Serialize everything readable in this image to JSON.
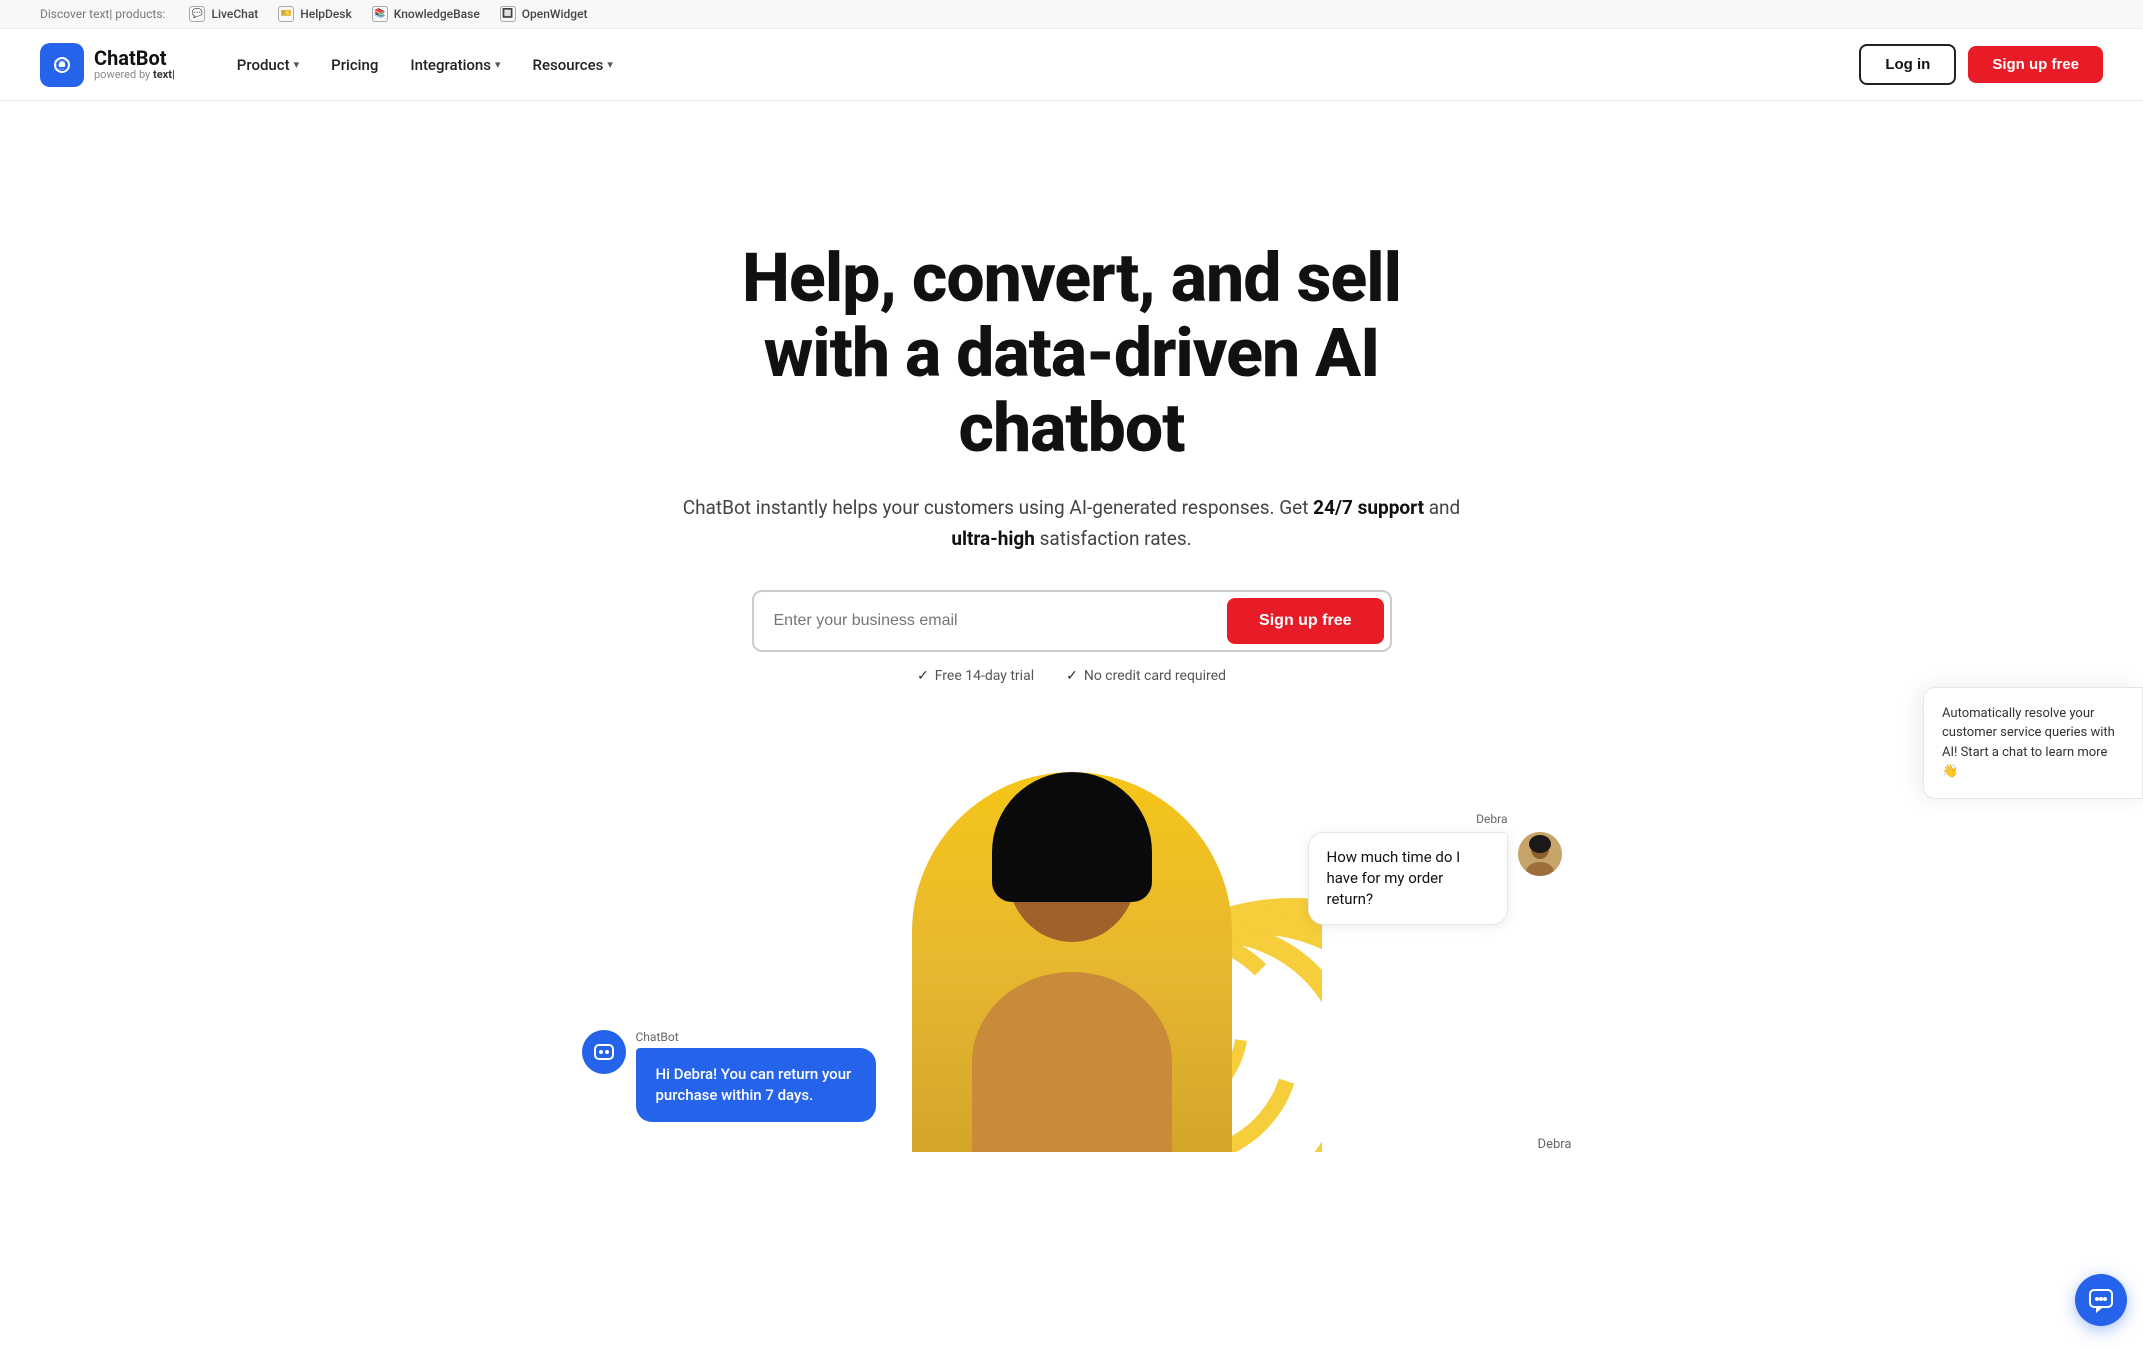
{
  "topbar": {
    "label": "Discover text| products:",
    "products": [
      {
        "name": "LiveChat",
        "icon": "💬"
      },
      {
        "name": "HelpDesk",
        "icon": "🎫"
      },
      {
        "name": "KnowledgeBase",
        "icon": "📚"
      },
      {
        "name": "OpenWidget",
        "icon": "🔲"
      }
    ]
  },
  "nav": {
    "logo_brand": "ChatBot",
    "logo_powered": "powered by text|",
    "product_label": "Product",
    "pricing_label": "Pricing",
    "integrations_label": "Integrations",
    "resources_label": "Resources",
    "login_label": "Log in",
    "signup_label": "Sign up free"
  },
  "hero": {
    "headline_line1": "Help, convert, and sell",
    "headline_line2": "with a data-driven AI chatbot",
    "subtext": "ChatBot instantly helps your customers using AI-generated responses. Get ",
    "subtext_bold1": "24/7 support",
    "subtext_mid": " and ",
    "subtext_bold2": "ultra-high",
    "subtext_end": " satisfaction rates.",
    "email_placeholder": "Enter your business email",
    "signup_cta": "Sign up free",
    "trust1": "Free 14-day trial",
    "trust2": "No credit card required"
  },
  "chatbot_bubble": {
    "label": "ChatBot",
    "message": "Hi Debra! You can return your purchase within 7 days."
  },
  "user_bubble": {
    "label": "Debra",
    "message": "How much time do I have for my order return?"
  },
  "right_tooltip": {
    "text": "Automatically resolve your customer service queries with AI! Start a chat to learn more 👋"
  },
  "colors": {
    "primary_blue": "#2563eb",
    "primary_red": "#e81c26",
    "accent_yellow": "#f5c518"
  }
}
